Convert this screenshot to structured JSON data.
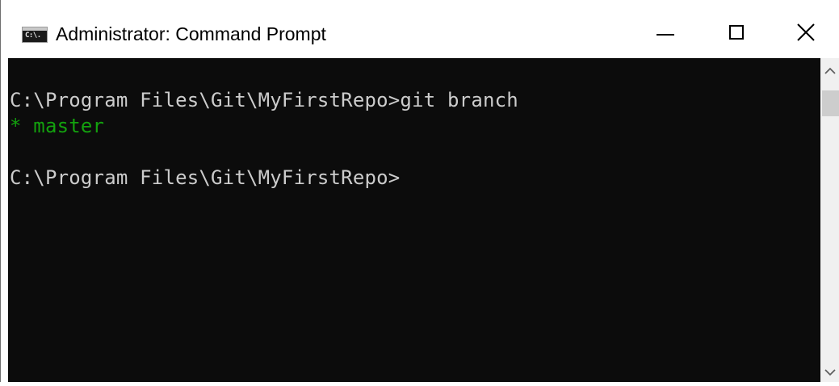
{
  "window": {
    "title": "Administrator: Command Prompt",
    "icon_label": "C:\\.",
    "controls": {
      "minimize": "minimize-icon",
      "maximize": "maximize-icon",
      "close": "close-icon"
    }
  },
  "console": {
    "lines": [
      "C:\\Program Files\\Git\\MyFirstRepo>git branch",
      "* master",
      "",
      "C:\\Program Files\\Git\\MyFirstRepo>"
    ],
    "colors": {
      "background": "#0c0c0c",
      "text": "#cccccc",
      "current_branch": "#13a10e"
    }
  },
  "scrollbar": {
    "up_icon": "chevron-up-icon",
    "down_icon": "chevron-down-icon"
  }
}
